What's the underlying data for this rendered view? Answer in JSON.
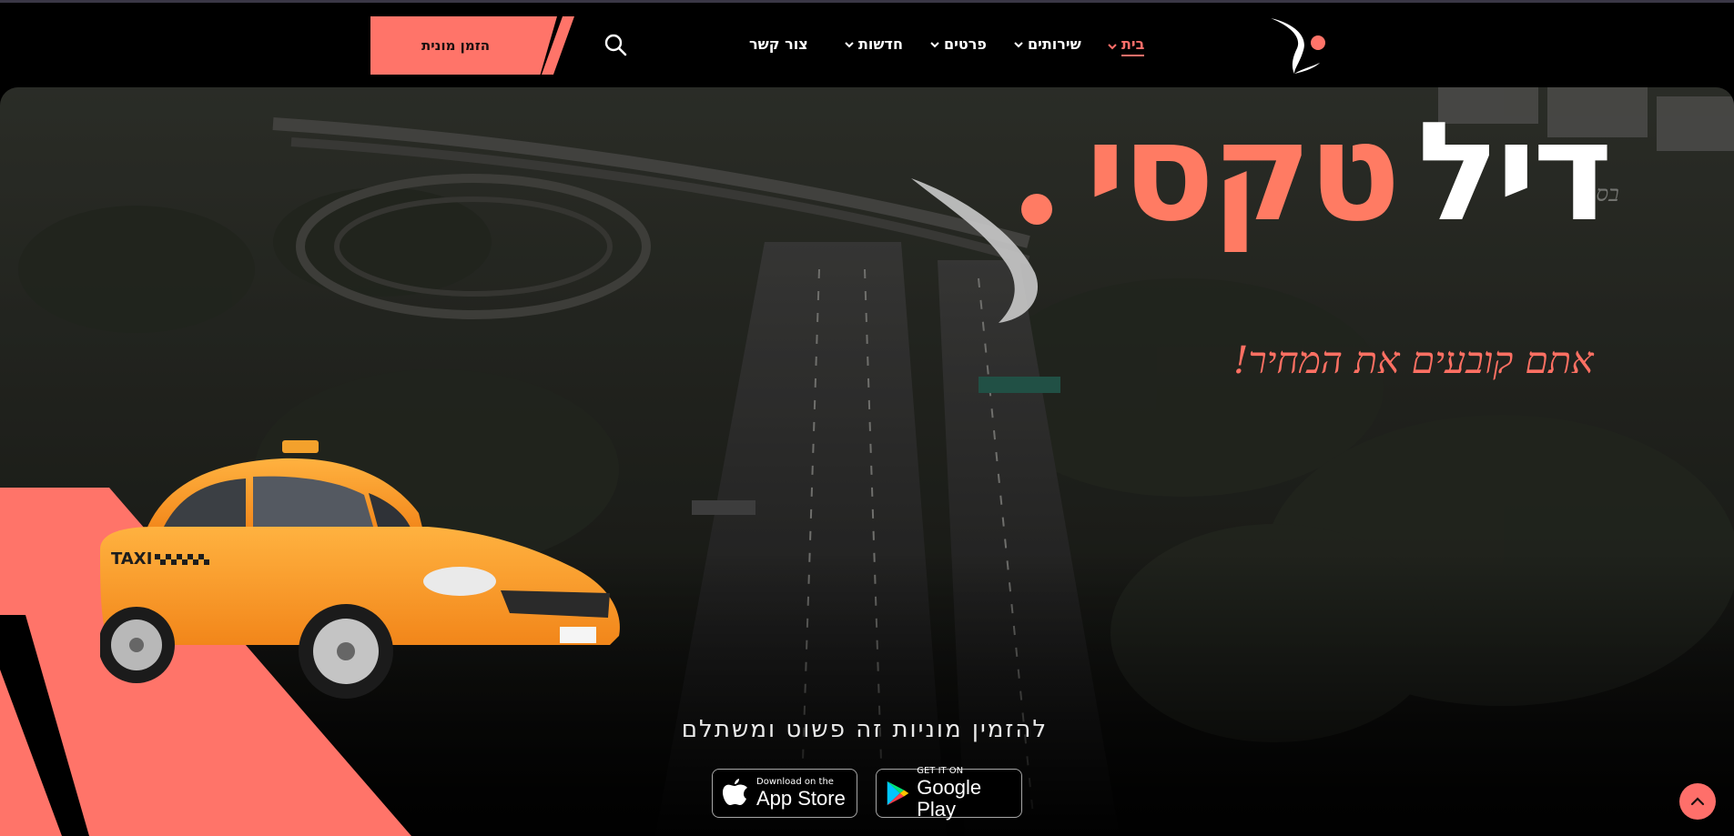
{
  "header": {
    "logo_icon": "brand-logo-icon",
    "nav": [
      {
        "label": "בית",
        "active": true,
        "has_dropdown": true
      },
      {
        "label": "שירותים",
        "active": false,
        "has_dropdown": true
      },
      {
        "label": "פרטים",
        "active": false,
        "has_dropdown": true
      },
      {
        "label": "חדשות",
        "active": false,
        "has_dropdown": true
      },
      {
        "label": "צור קשר",
        "active": false,
        "has_dropdown": false
      }
    ],
    "search_icon": "search-icon",
    "order_button_label": "הזמן מונית"
  },
  "hero": {
    "kasad": "בס\"ד",
    "brand_white": "דיל",
    "brand_coral": "טקסי",
    "tagline": "אתם קובעים את המחיר!",
    "subtitle": "להזמין מוניות זה פשוט ומשתלם",
    "app_store": {
      "small": "Download on the",
      "big": "App Store"
    },
    "google_play": {
      "small": "GET IT ON",
      "big": "Google Play"
    },
    "taxi_sign": "TAXI"
  },
  "colors": {
    "accent": "#ff7469",
    "brand_coral": "#ff7b63",
    "background": "#000000"
  },
  "scroll_top_icon": "chevron-up-icon"
}
